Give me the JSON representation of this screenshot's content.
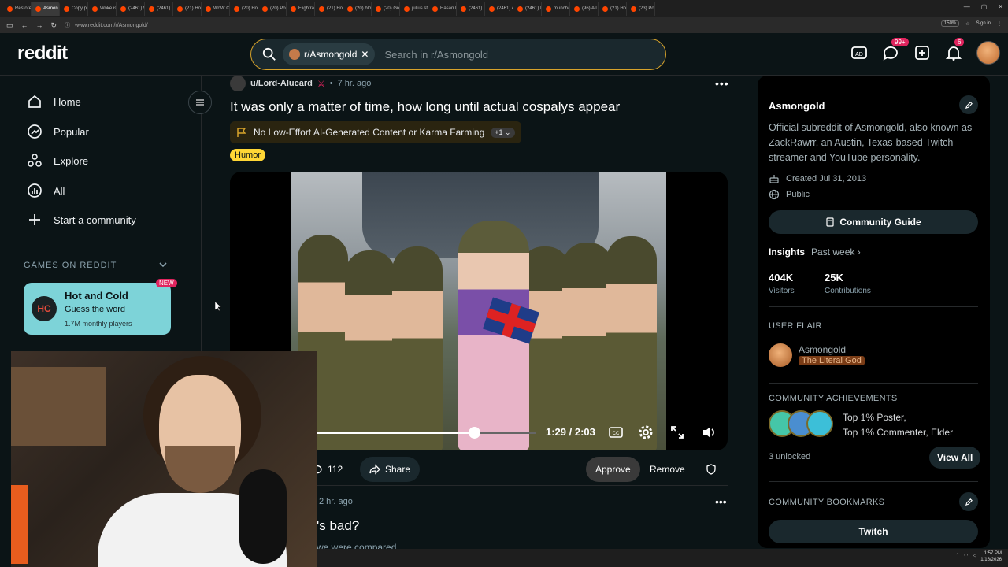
{
  "browser": {
    "tabs": [
      "Restore S",
      "Asmon",
      "Copy pas",
      "Woke is f",
      "(2461) Wi",
      "(2461) ni",
      "(21) Hom",
      "WoW Cla",
      "(20) Hom",
      "(20) Post",
      "Flightrad",
      "(21) Hom",
      "(20) bloo",
      "(20) Grok",
      "julius stre",
      "Hasan Pik",
      "(2461) Wi",
      "(2461) Alp",
      "(2461) Ins",
      "munchau",
      "(96) All C",
      "(21) Hom",
      "(23) Post"
    ],
    "url": "www.reddit.com/r/Asmongold/",
    "zoom": "150%",
    "sign_in": "Sign in"
  },
  "header": {
    "logo": "reddit",
    "search_chip": "r/Asmongold",
    "search_placeholder": "Search in r/Asmongold",
    "chat_badge": "99+",
    "notif_badge": "6"
  },
  "left_sidebar": {
    "items": [
      "Home",
      "Popular",
      "Explore",
      "All",
      "Start a community"
    ],
    "games_header": "GAMES ON REDDIT",
    "game": {
      "title": "Hot and Cold",
      "subtitle": "Guess the word",
      "players": "1.7M monthly players",
      "badge": "NEW",
      "logo": "HC"
    }
  },
  "post": {
    "author": "u/Lord-Alucard",
    "time": "7 hr. ago",
    "title": "It was only a matter of time, how long until actual cospalys appear",
    "rule": "No Low-Effort AI-Generated Content or Karma Farming",
    "rule_more": "+1",
    "flair": "Humor",
    "video": {
      "time": "1:29 / 2:03",
      "progress": 0.72
    },
    "comments": "112",
    "share": "Share",
    "approve": "Approve",
    "remove": "Remove"
  },
  "post2": {
    "time": "2 hr. ago",
    "title": "'s bad?",
    "body": "we were compared"
  },
  "right_sidebar": {
    "title": "Asmongold",
    "description": "Official subreddit of Asmongold, also known as ZackRawrr, an Austin, Texas-based Twitch streamer and YouTube personality.",
    "created": "Created Jul 31, 2013",
    "visibility": "Public",
    "guide_button": "Community Guide",
    "insights_label": "Insights",
    "insights_period": "Past week",
    "visitors_value": "404K",
    "visitors_label": "Visitors",
    "contrib_value": "25K",
    "contrib_label": "Contributions",
    "user_flair_header": "USER FLAIR",
    "flair_user": "Asmongold",
    "flair_text": "The Literal God",
    "achievements_header": "COMMUNITY ACHIEVEMENTS",
    "achievement_1": "Top 1% Poster,",
    "achievement_2": "Top 1% Commenter, Elder",
    "unlocked": "3 unlocked",
    "view_all": "View All",
    "bookmarks_header": "COMMUNITY BOOKMARKS",
    "bookmark_1": "Twitch"
  },
  "taskbar": {
    "time": "1:57 PM",
    "date": "1/16/2026"
  },
  "colors": {
    "accent": "#ff4500",
    "search_border": "#d7a32b",
    "flair": "#ffd635",
    "game_card": "#7dd3d8"
  }
}
